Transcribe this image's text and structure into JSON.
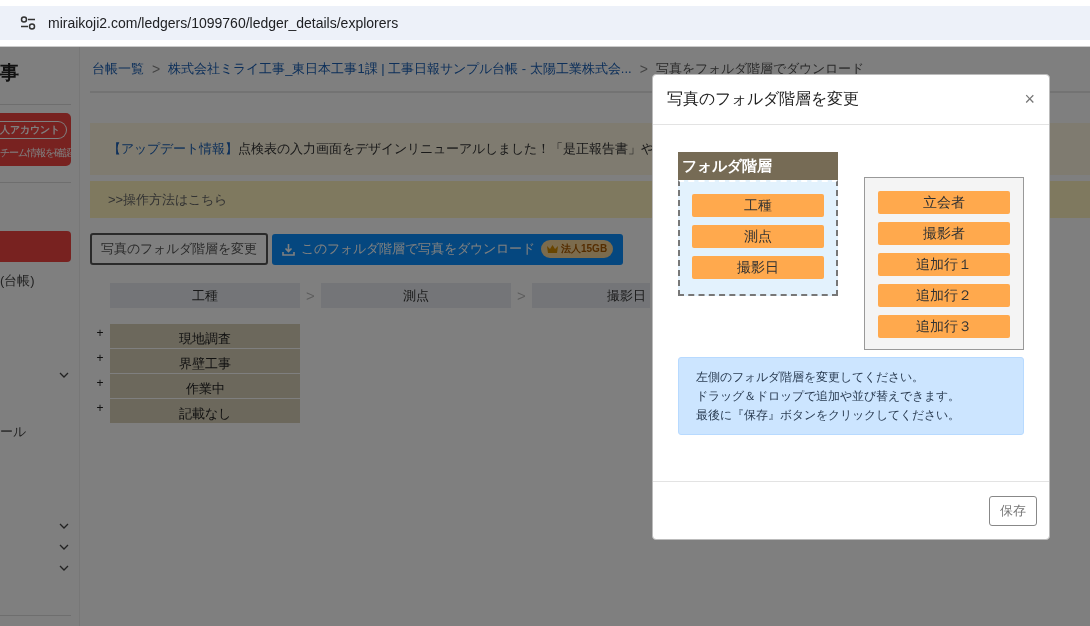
{
  "browser": {
    "url": "miraikoji2.com/ledgers/1099760/ledger_details/explorers"
  },
  "sidebar": {
    "title": "事",
    "account_badge": "人アカウント",
    "team_link": "チーム情報を確認",
    "items": [
      {
        "kind": "bar"
      },
      {
        "kind": "text",
        "label": "(台帳)"
      },
      {
        "kind": "chevron"
      },
      {
        "kind": "text",
        "label": "ール"
      },
      {
        "kind": "chevron"
      },
      {
        "kind": "chevron"
      },
      {
        "kind": "chevron"
      }
    ]
  },
  "breadcrumb": [
    {
      "kind": "link",
      "label": "台帳一覧"
    },
    {
      "kind": "separator",
      "label": ">"
    },
    {
      "kind": "link",
      "label": "株式会社ミライ工事_東日本工事1課 | 工事日報サンプル台帳 - 太陽工業株式会..."
    },
    {
      "kind": "separator",
      "label": ">"
    },
    {
      "kind": "current",
      "label": "写真をフォルダ階層でダウンロード"
    }
  ],
  "notice": {
    "tag": "【アップデート情報】",
    "text": "点検表の入力画面をデザインリニューアルしました！「是正報告書」や"
  },
  "help_link": ">>操作方法はこちら",
  "toolbar": {
    "change_button": "写真のフォルダ階層を変更",
    "download_button": "このフォルダ階層で写真をダウンロード",
    "plan_badge": "法人15GB"
  },
  "hierarchy_columns": [
    {
      "kind": "column",
      "label": "工種"
    },
    {
      "kind": "separator",
      "label": ">"
    },
    {
      "kind": "column",
      "label": "測点"
    },
    {
      "kind": "separator",
      "label": ">"
    },
    {
      "kind": "column",
      "label": "撮影日"
    }
  ],
  "folders": [
    {
      "expander": "+",
      "label": "現地調査"
    },
    {
      "expander": "+",
      "label": "界壁工事"
    },
    {
      "expander": "+",
      "label": "作業中"
    },
    {
      "expander": "+",
      "label": "記載なし"
    }
  ],
  "modal": {
    "title": "写真のフォルダ階層を変更",
    "close": "×",
    "hierarchy_title": "フォルダ階層",
    "selected_fields": [
      "工種",
      "測点",
      "撮影日"
    ],
    "available_fields": [
      "立会者",
      "撮影者",
      "追加行１",
      "追加行２",
      "追加行３"
    ],
    "instructions": [
      "左側のフォルダ階層を変更してください。",
      "ドラッグ＆ドロップで追加や並び替えできます。",
      "最後に『保存』ボタンをクリックしてください。"
    ],
    "save_button": "保存"
  }
}
